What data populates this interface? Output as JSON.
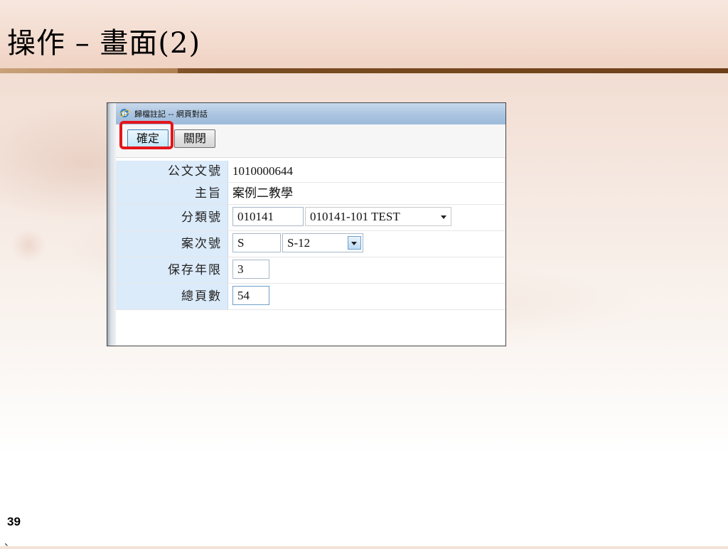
{
  "slide": {
    "title": "操作 – 畫面(2)",
    "page_number": "39",
    "corner_mark": "、"
  },
  "dialog": {
    "title": "歸檔註記 -- 網頁對話",
    "buttons": {
      "ok_label": "確定",
      "close_label": "關閉"
    },
    "fields": {
      "doc_no": {
        "label": "公文文號",
        "value": "1010000644"
      },
      "subject": {
        "label": "主旨",
        "value": "案例二教學"
      },
      "category": {
        "label": "分類號",
        "code": "010141",
        "selected": "010141-101 TEST"
      },
      "case_no": {
        "label": "案次號",
        "prefix": "S",
        "selected": "S-12"
      },
      "retention": {
        "label": "保存年限",
        "value": "3"
      },
      "pages": {
        "label": "總頁數",
        "value": "54"
      }
    }
  },
  "colors": {
    "highlight": "#e4151b",
    "label_bg": "#dcebfa",
    "title_rule": "#6e4019"
  }
}
